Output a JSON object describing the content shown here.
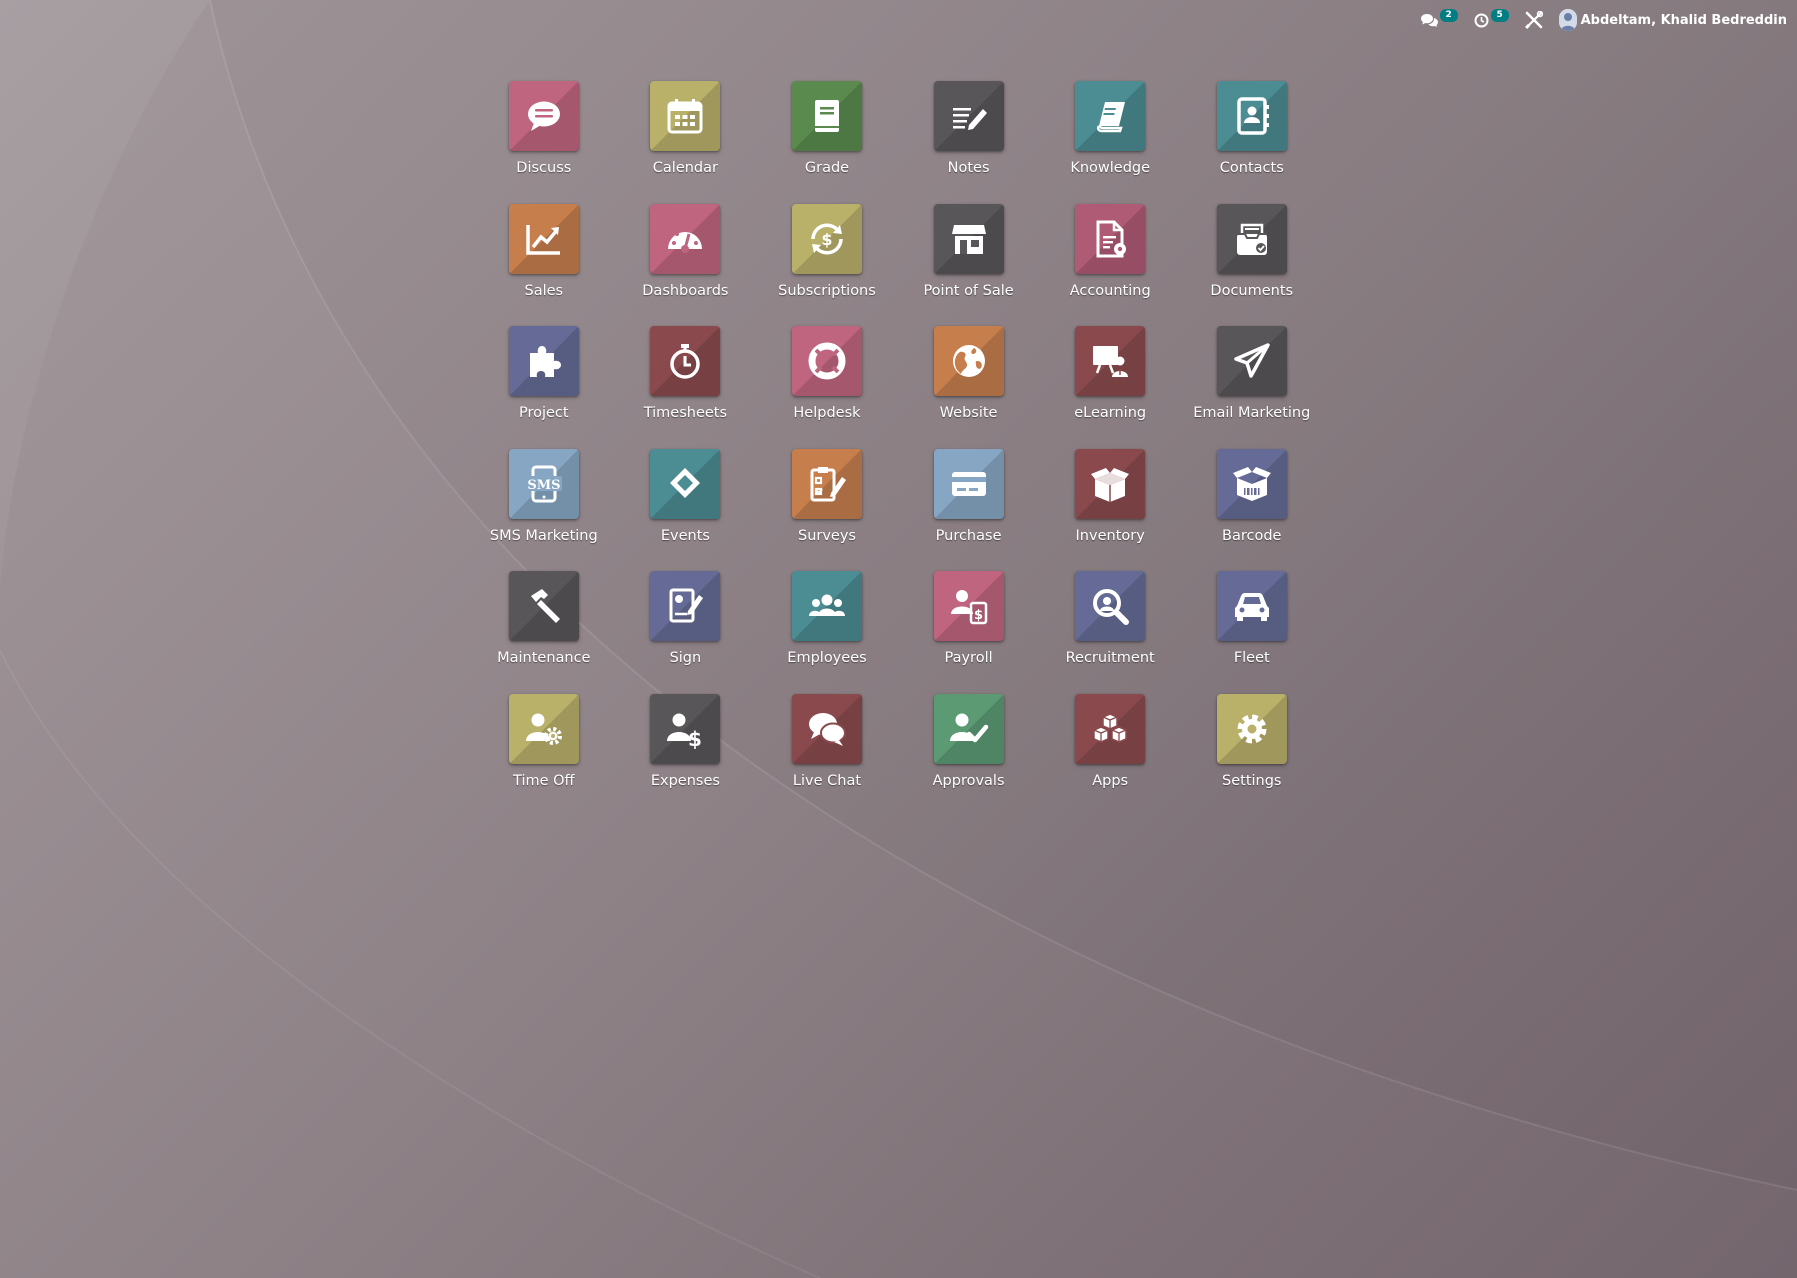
{
  "systray": {
    "messages_count": "2",
    "activities_count": "5",
    "user_name": "Abdeltam, Khalid Bedreddin"
  },
  "apps": [
    {
      "label": "Discuss",
      "icon": "chat-bubble-icon",
      "color": "#c0657f"
    },
    {
      "label": "Calendar",
      "icon": "calendar-icon",
      "color": "#b9b06a"
    },
    {
      "label": "Grade",
      "icon": "book-icon",
      "color": "#5a8a4e"
    },
    {
      "label": "Notes",
      "icon": "notes-icon",
      "color": "#595659"
    },
    {
      "label": "Knowledge",
      "icon": "knowledge-book-icon",
      "color": "#4c8c93"
    },
    {
      "label": "Contacts",
      "icon": "address-book-icon",
      "color": "#4c8c93"
    },
    {
      "label": "Sales",
      "icon": "trend-chart-icon",
      "color": "#c67e4d"
    },
    {
      "label": "Dashboards",
      "icon": "speedometer-icon",
      "color": "#c0657f"
    },
    {
      "label": "Subscriptions",
      "icon": "recurring-dollar-icon",
      "color": "#b9b06a"
    },
    {
      "label": "Point of Sale",
      "icon": "shop-icon",
      "color": "#595659"
    },
    {
      "label": "Accounting",
      "icon": "invoice-gear-icon",
      "color": "#b05b76"
    },
    {
      "label": "Documents",
      "icon": "document-box-icon",
      "color": "#595659"
    },
    {
      "label": "Project",
      "icon": "puzzle-icon",
      "color": "#656b96"
    },
    {
      "label": "Timesheets",
      "icon": "stopwatch-icon",
      "color": "#8a4a4d"
    },
    {
      "label": "Helpdesk",
      "icon": "lifebuoy-icon",
      "color": "#c0657f"
    },
    {
      "label": "Website",
      "icon": "globe-icon",
      "color": "#c67e4d"
    },
    {
      "label": "eLearning",
      "icon": "teacher-board-icon",
      "color": "#8a4a4d"
    },
    {
      "label": "Email Marketing",
      "icon": "paper-plane-icon",
      "color": "#595659"
    },
    {
      "label": "SMS Marketing",
      "icon": "sms-phone-icon",
      "color": "#87a6c4"
    },
    {
      "label": "Events",
      "icon": "ticket-icon",
      "color": "#4c8c93"
    },
    {
      "label": "Surveys",
      "icon": "checklist-pen-icon",
      "color": "#c67e4d"
    },
    {
      "label": "Purchase",
      "icon": "credit-card-icon",
      "color": "#87a6c4"
    },
    {
      "label": "Inventory",
      "icon": "open-box-icon",
      "color": "#8a4a4d"
    },
    {
      "label": "Barcode",
      "icon": "barcode-box-icon",
      "color": "#656b96"
    },
    {
      "label": "Maintenance",
      "icon": "hammer-icon",
      "color": "#595659"
    },
    {
      "label": "Sign",
      "icon": "signature-icon",
      "color": "#656b96"
    },
    {
      "label": "Employees",
      "icon": "group-users-icon",
      "color": "#4c8c93"
    },
    {
      "label": "Payroll",
      "icon": "user-payslip-icon",
      "color": "#c0657f"
    },
    {
      "label": "Recruitment",
      "icon": "magnifier-icon",
      "color": "#656b96"
    },
    {
      "label": "Fleet",
      "icon": "car-icon",
      "color": "#656b96"
    },
    {
      "label": "Time Off",
      "icon": "user-gear-icon",
      "color": "#b9b06a"
    },
    {
      "label": "Expenses",
      "icon": "user-dollar-icon",
      "color": "#595659"
    },
    {
      "label": "Live Chat",
      "icon": "chat-bubbles-icon",
      "color": "#8a4a4d"
    },
    {
      "label": "Approvals",
      "icon": "user-check-icon",
      "color": "#5c9a74"
    },
    {
      "label": "Apps",
      "icon": "cubes-icon",
      "color": "#8a4a4d"
    },
    {
      "label": "Settings",
      "icon": "gear-icon",
      "color": "#b9b06a"
    }
  ]
}
